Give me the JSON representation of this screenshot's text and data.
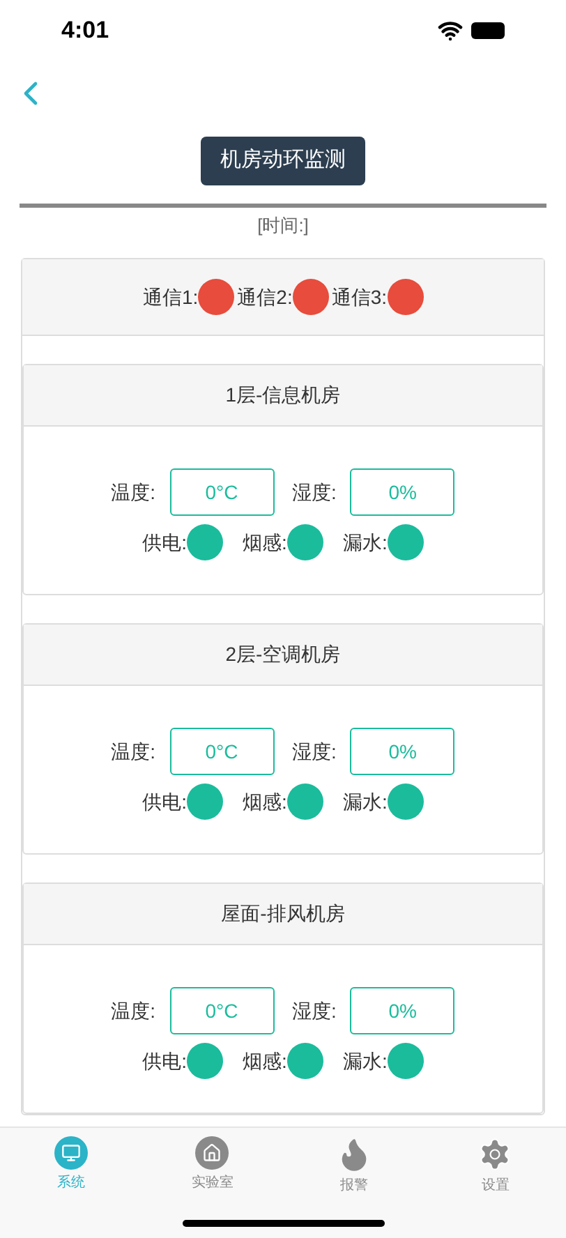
{
  "status_bar": {
    "time": "4:01"
  },
  "title": "机房动环监测",
  "time_label": "[时间:]",
  "comms": [
    {
      "label": "通信1:",
      "color": "#e74c3c"
    },
    {
      "label": "通信2:",
      "color": "#e74c3c"
    },
    {
      "label": "通信3:",
      "color": "#e74c3c"
    }
  ],
  "rooms": [
    {
      "name": "1层-信息机房",
      "temp_label": "温度:",
      "temp": "0°C",
      "hum_label": "湿度:",
      "hum": "0%",
      "sensors": [
        {
          "label": "供电:",
          "color": "#1abc9c"
        },
        {
          "label": "烟感:",
          "color": "#1abc9c"
        },
        {
          "label": "漏水:",
          "color": "#1abc9c"
        }
      ]
    },
    {
      "name": "2层-空调机房",
      "temp_label": "温度:",
      "temp": "0°C",
      "hum_label": "湿度:",
      "hum": "0%",
      "sensors": [
        {
          "label": "供电:",
          "color": "#1abc9c"
        },
        {
          "label": "烟感:",
          "color": "#1abc9c"
        },
        {
          "label": "漏水:",
          "color": "#1abc9c"
        }
      ]
    },
    {
      "name": "屋面-排风机房",
      "temp_label": "温度:",
      "temp": "0°C",
      "hum_label": "湿度:",
      "hum": "0%",
      "sensors": [
        {
          "label": "供电:",
          "color": "#1abc9c"
        },
        {
          "label": "烟感:",
          "color": "#1abc9c"
        },
        {
          "label": "漏水:",
          "color": "#1abc9c"
        }
      ]
    }
  ],
  "tabs": [
    {
      "kind": "monitor",
      "label": "系统",
      "selected": true
    },
    {
      "kind": "home",
      "label": "实验室",
      "selected": false
    },
    {
      "kind": "flame",
      "label": "报警",
      "selected": false
    },
    {
      "kind": "gear",
      "label": "设置",
      "selected": false
    }
  ]
}
